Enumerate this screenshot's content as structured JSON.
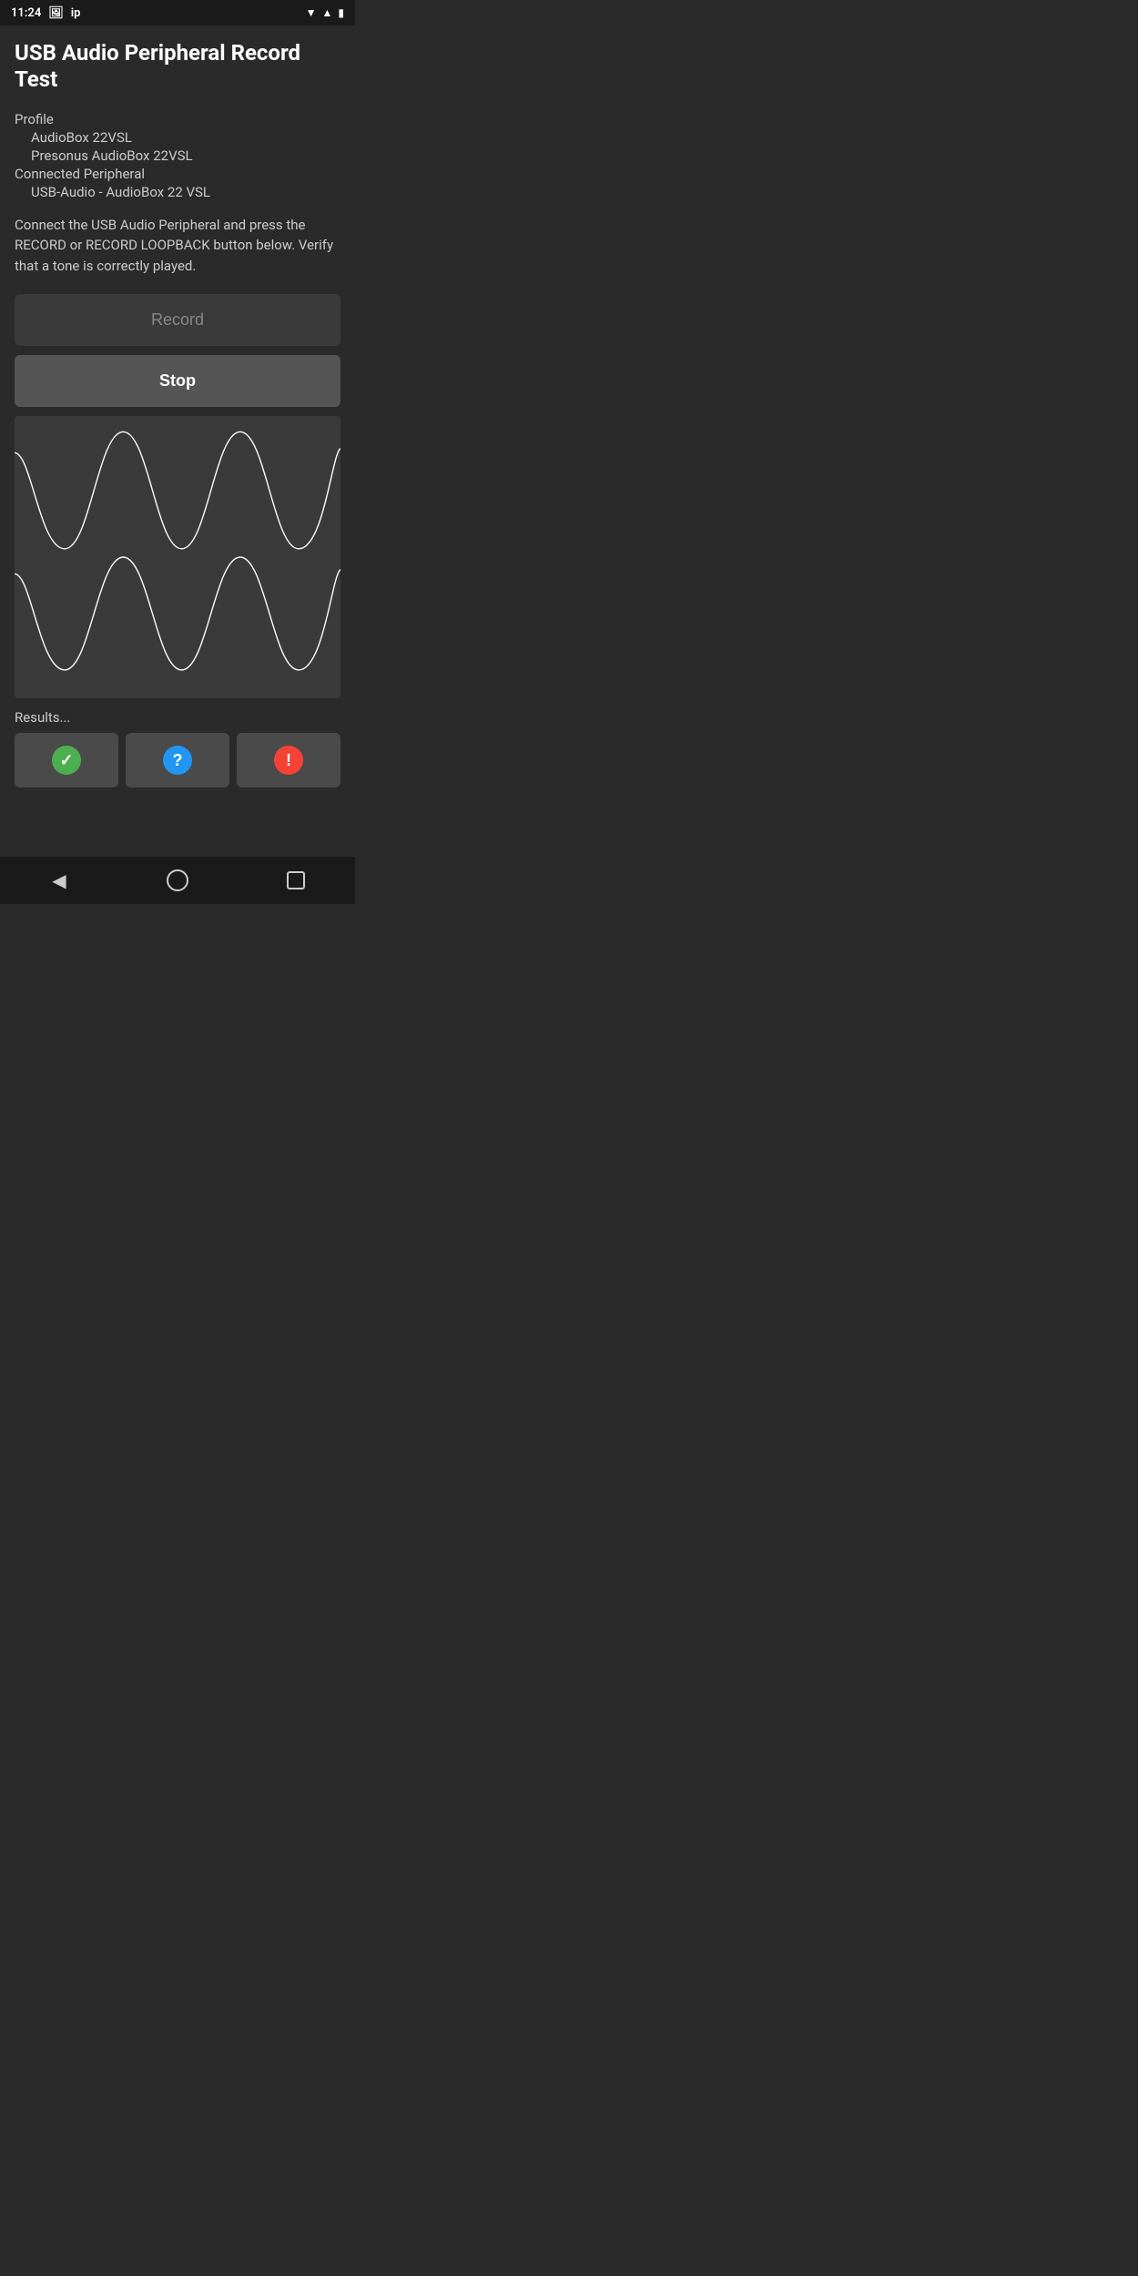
{
  "status_bar": {
    "time": "11:24",
    "icons": [
      "image",
      "ip",
      "wifi",
      "signal",
      "battery"
    ]
  },
  "page": {
    "title": "USB Audio Peripheral Record Test",
    "profile_label": "Profile",
    "profile_name": "AudioBox 22VSL",
    "profile_sub": "Presonus AudioBox 22VSL",
    "peripheral_label": "Connected Peripheral",
    "peripheral_name": "USB-Audio - AudioBox 22 VSL",
    "description": "Connect the USB Audio Peripheral and press the RECORD or RECORD LOOPBACK button below. Verify that a tone is correctly played.",
    "record_button": "Record",
    "stop_button": "Stop",
    "results_label": "Results...",
    "result_buttons": [
      {
        "type": "success",
        "icon": "✓",
        "color_class": "green"
      },
      {
        "type": "question",
        "icon": "?",
        "color_class": "blue"
      },
      {
        "type": "error",
        "icon": "!",
        "color_class": "red"
      }
    ]
  }
}
